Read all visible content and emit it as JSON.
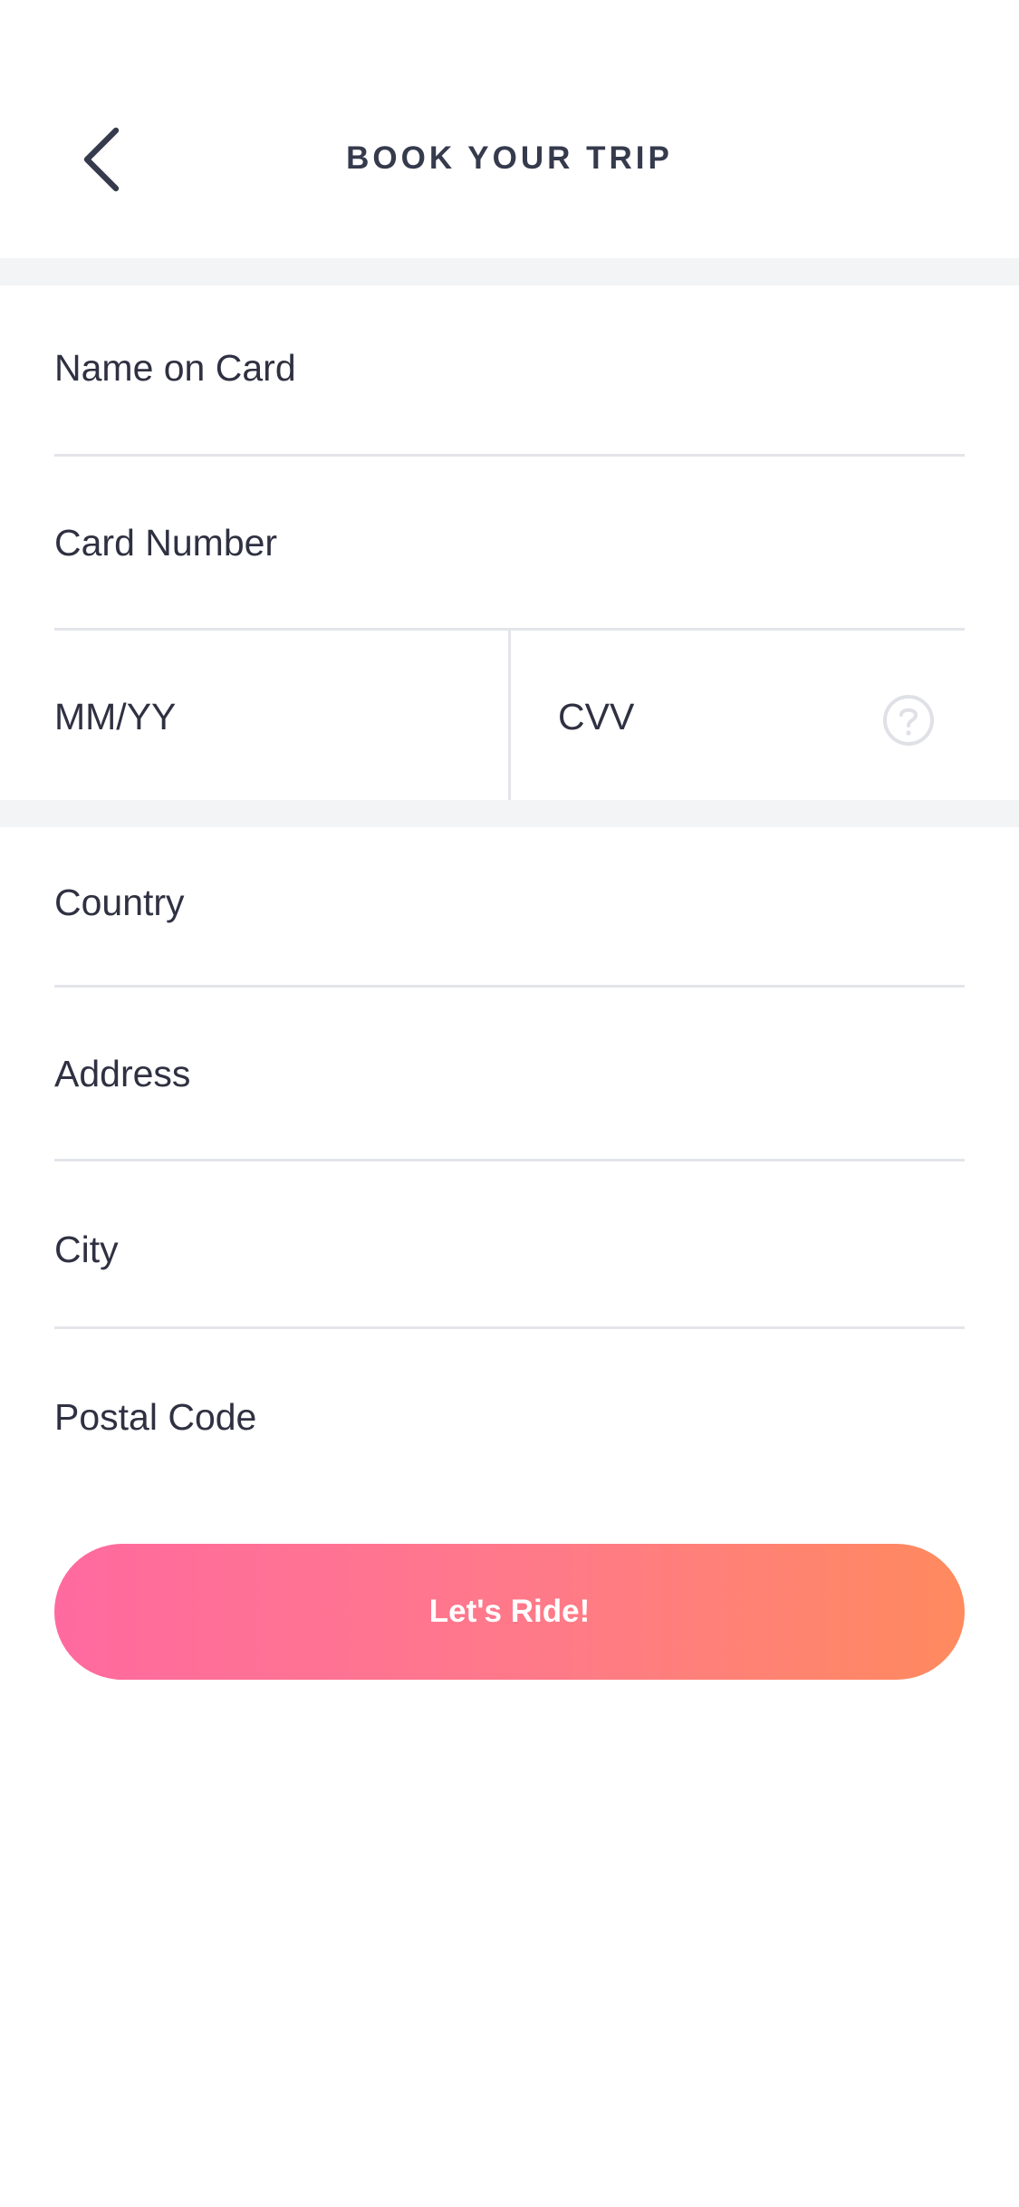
{
  "header": {
    "title": "BOOK YOUR TRIP",
    "back_icon": "chevron-left-icon"
  },
  "card": {
    "name_label": "Name on Card",
    "number_label": "Card Number",
    "expiry_label": "MM/YY",
    "cvv_label": "CVV",
    "cvv_help_icon": "question-circle-icon"
  },
  "billing": {
    "country_label": "Country",
    "address_label": "Address",
    "city_label": "City",
    "postal_label": "Postal Code"
  },
  "cta": {
    "label": "Let's Ride!",
    "gradient_start": "#ff6a9f",
    "gradient_end": "#ff8a5e"
  },
  "colors": {
    "text": "#2f3142",
    "divider": "#e3e5ea",
    "section_bg": "#f3f4f6"
  }
}
